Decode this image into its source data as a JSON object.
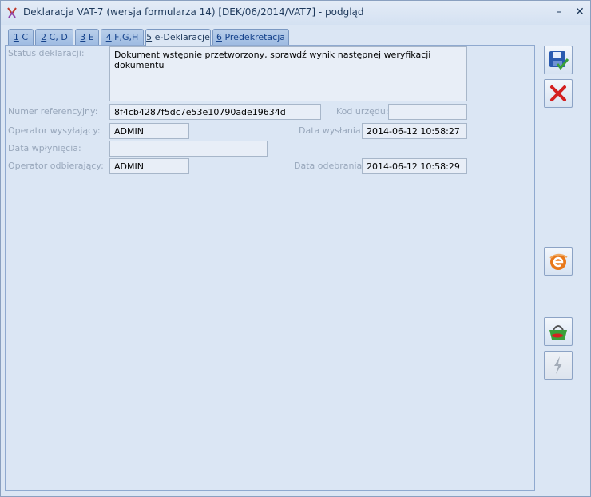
{
  "window": {
    "title": "Deklaracja VAT-7 (wersja formularza 14) [DEK/06/2014/VAT7] - podgląd",
    "minimize_label": "–",
    "close_label": "✕"
  },
  "tabs": [
    {
      "key": "1",
      "rest": " C"
    },
    {
      "key": "2",
      "rest": " C, D"
    },
    {
      "key": "3",
      "rest": " E"
    },
    {
      "key": "4",
      "rest": " F,G,H"
    },
    {
      "key": "5",
      "rest": " e-Deklaracje"
    },
    {
      "key": "6",
      "rest": " Predekretacja"
    }
  ],
  "active_tab_index": 4,
  "form": {
    "status_label": "Status deklaracji:",
    "status_value": "Dokument wstępnie przetworzony, sprawdź wynik następnej weryfikacji dokumentu",
    "ref_label": "Numer referencyjny:",
    "ref_value": "8f4cb4287f5dc7e53e10790ade19634d",
    "office_label": "Kod urzędu:",
    "office_value": "",
    "sender_label": "Operator wysyłający:",
    "sender_value": "ADMIN",
    "sent_date_label": "Data wysłania:",
    "sent_date_value": "2014-06-12 10:58:27",
    "payment_label": "Data wpłynięcia:",
    "payment_value": "",
    "receiver_label": "Operator odbierający:",
    "receiver_value": "ADMIN",
    "received_date_label": "Data odebrania:",
    "received_date_value": "2014-06-12 10:58:29"
  },
  "side_buttons": [
    "save-icon",
    "cancel-icon",
    "e-declaration-icon",
    "basket-icon",
    "lightning-icon"
  ],
  "colors": {
    "panel_bg": "#dbe6f4",
    "field_bg": "#e8eef7",
    "label": "#98a7bb",
    "save_blue": "#2a5bb0",
    "cancel_red": "#d42020",
    "edecl_orange": "#e8781a",
    "basket_green": "#3aa03a"
  }
}
